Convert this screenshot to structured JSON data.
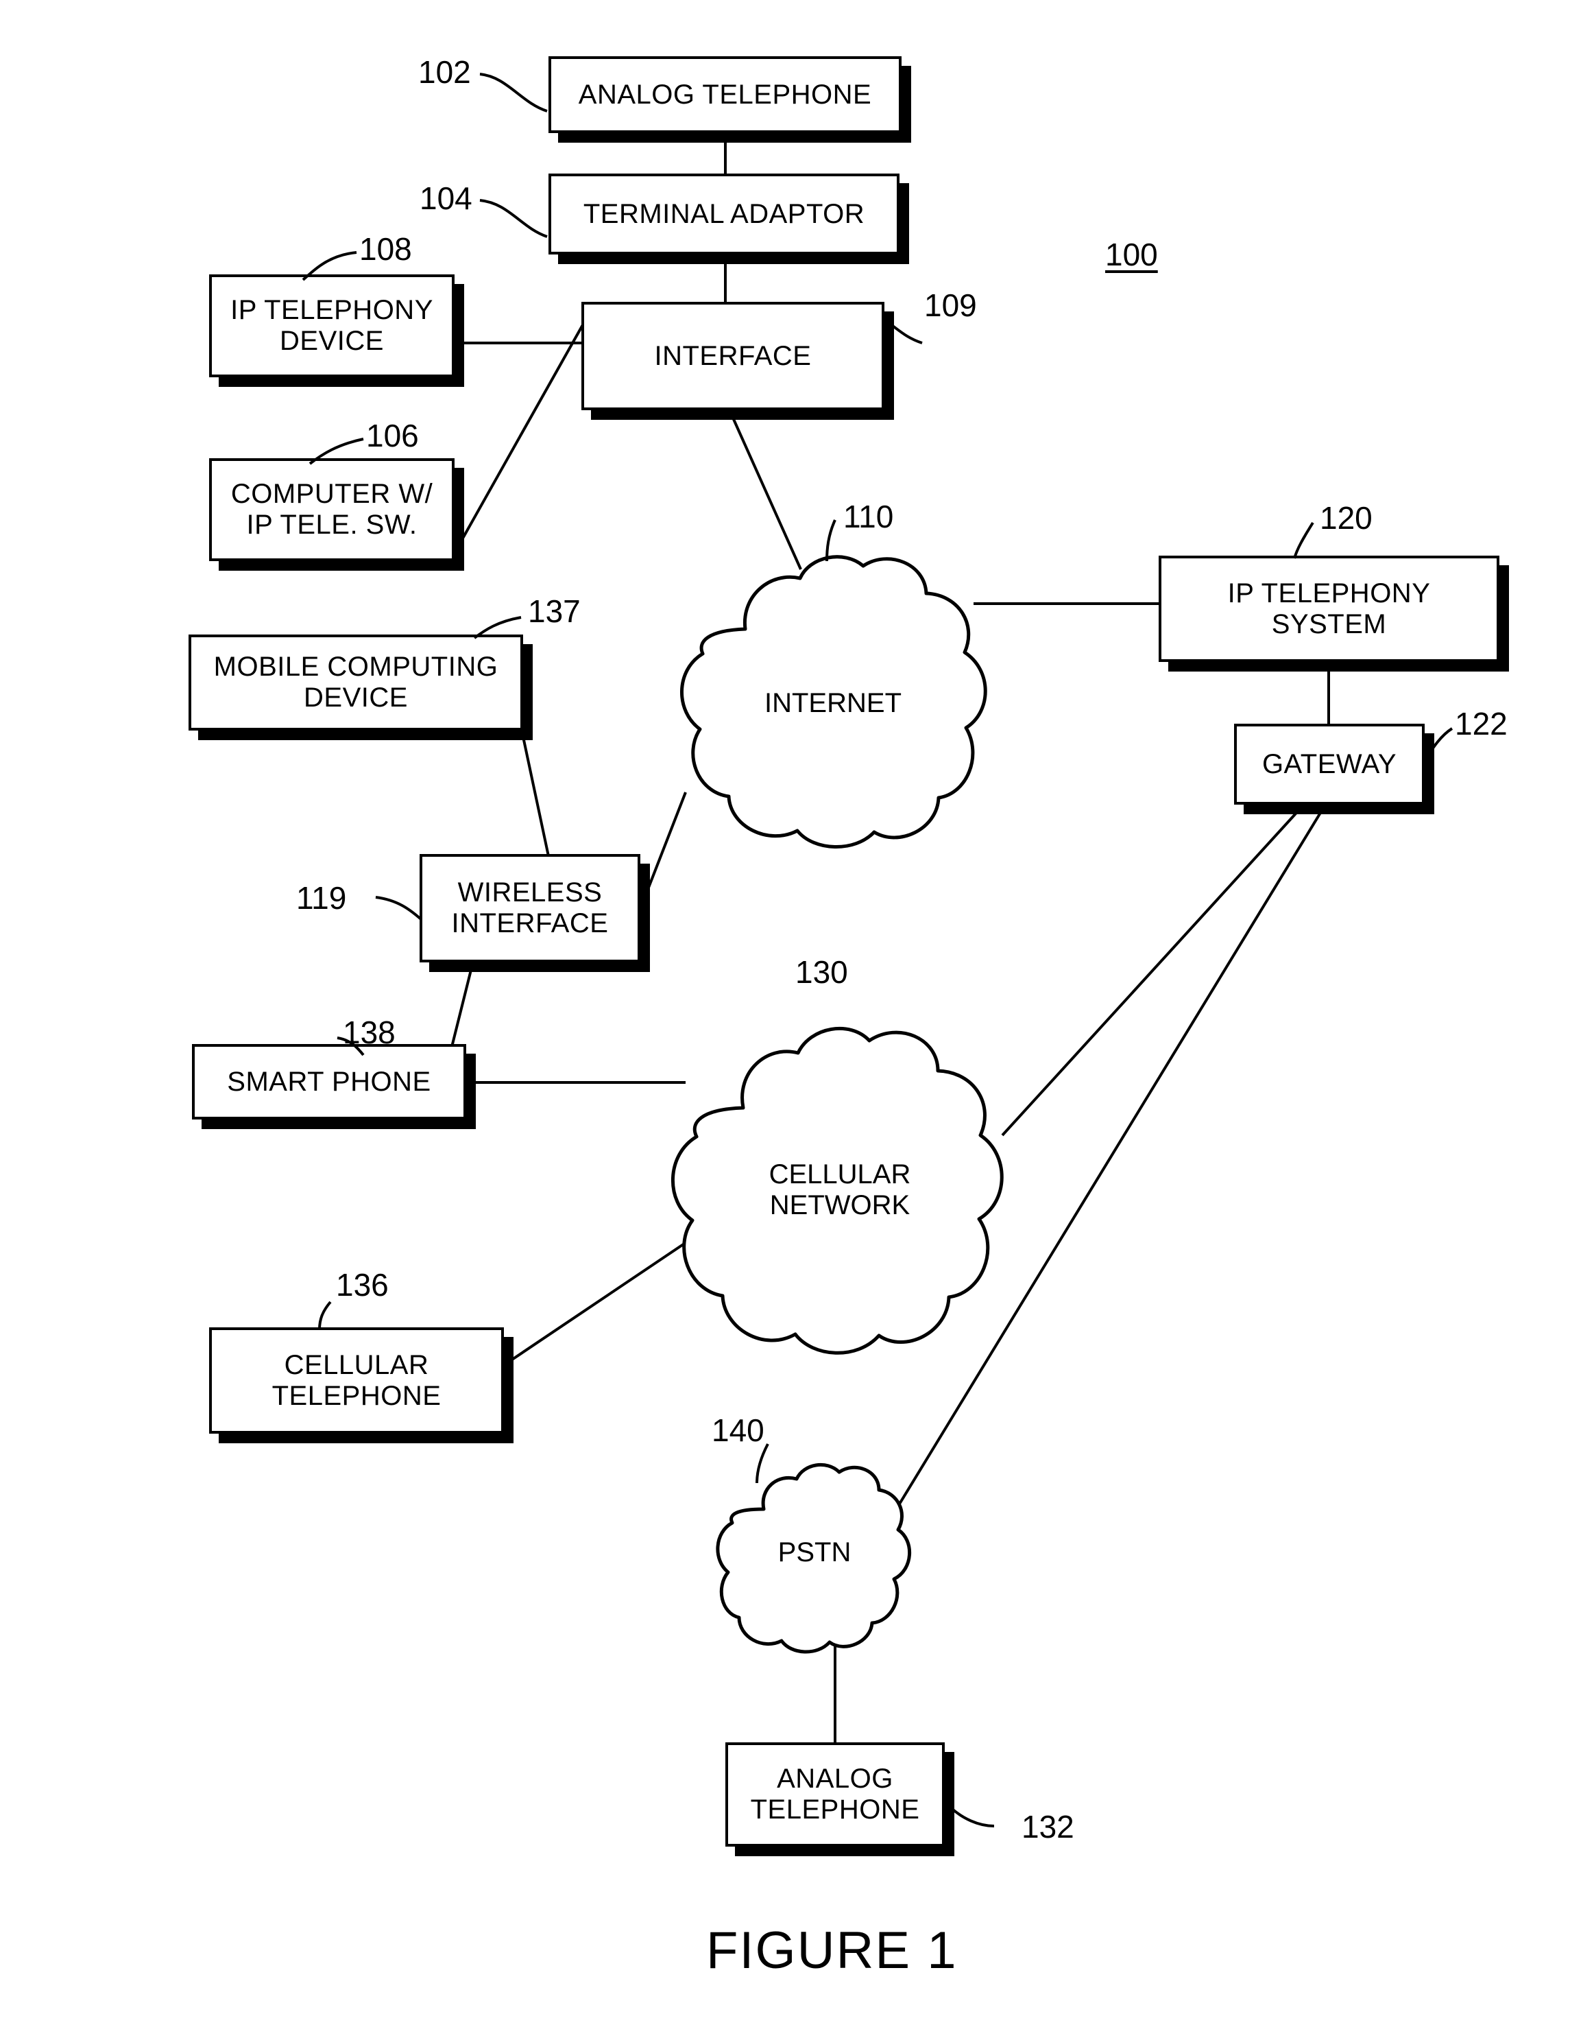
{
  "figure": {
    "caption": "FIGURE 1",
    "system_ref": "100"
  },
  "nodes": [
    {
      "id": "analog-telephone-102",
      "label": "ANALOG TELEPHONE",
      "ref": "102"
    },
    {
      "id": "terminal-adaptor-104",
      "label": "TERMINAL ADAPTOR",
      "ref": "104"
    },
    {
      "id": "interface-109",
      "label": "INTERFACE",
      "ref": "109"
    },
    {
      "id": "ip-telephony-device-108",
      "label": "IP TELEPHONY\nDEVICE",
      "ref": "108"
    },
    {
      "id": "computer-106",
      "label": "COMPUTER W/\nIP TELE. SW.",
      "ref": "106"
    },
    {
      "id": "mobile-computing-device-137",
      "label": "MOBILE COMPUTING\nDEVICE",
      "ref": "137"
    },
    {
      "id": "wireless-interface-119",
      "label": "WIRELESS\nINTERFACE",
      "ref": "119"
    },
    {
      "id": "smart-phone-138",
      "label": "SMART PHONE",
      "ref": "138"
    },
    {
      "id": "cellular-telephone-136",
      "label": "CELLULAR\nTELEPHONE",
      "ref": "136"
    },
    {
      "id": "ip-telephony-system-120",
      "label": "IP TELEPHONY\nSYSTEM",
      "ref": "120"
    },
    {
      "id": "gateway-122",
      "label": "GATEWAY",
      "ref": "122"
    },
    {
      "id": "analog-telephone-132",
      "label": "ANALOG\nTELEPHONE",
      "ref": "132"
    }
  ],
  "clouds": [
    {
      "id": "internet-110",
      "label": "INTERNET",
      "ref": "110"
    },
    {
      "id": "cellular-network-130",
      "label": "CELLULAR\nNETWORK",
      "ref": "130"
    },
    {
      "id": "pstn-140",
      "label": "PSTN",
      "ref": "140"
    }
  ],
  "connections": [
    {
      "from": "analog-telephone-102",
      "to": "terminal-adaptor-104"
    },
    {
      "from": "terminal-adaptor-104",
      "to": "interface-109"
    },
    {
      "from": "ip-telephony-device-108",
      "to": "interface-109"
    },
    {
      "from": "computer-106",
      "to": "interface-109"
    },
    {
      "from": "interface-109",
      "to": "internet-110"
    },
    {
      "from": "internet-110",
      "to": "ip-telephony-system-120"
    },
    {
      "from": "ip-telephony-system-120",
      "to": "gateway-122"
    },
    {
      "from": "gateway-122",
      "to": "cellular-network-130"
    },
    {
      "from": "gateway-122",
      "to": "pstn-140"
    },
    {
      "from": "mobile-computing-device-137",
      "to": "wireless-interface-119"
    },
    {
      "from": "wireless-interface-119",
      "to": "internet-110"
    },
    {
      "from": "wireless-interface-119",
      "to": "smart-phone-138"
    },
    {
      "from": "smart-phone-138",
      "to": "cellular-network-130"
    },
    {
      "from": "cellular-telephone-136",
      "to": "cellular-network-130"
    },
    {
      "from": "pstn-140",
      "to": "analog-telephone-132"
    }
  ],
  "colors": {
    "ink": "#000000",
    "paper": "#ffffff"
  }
}
